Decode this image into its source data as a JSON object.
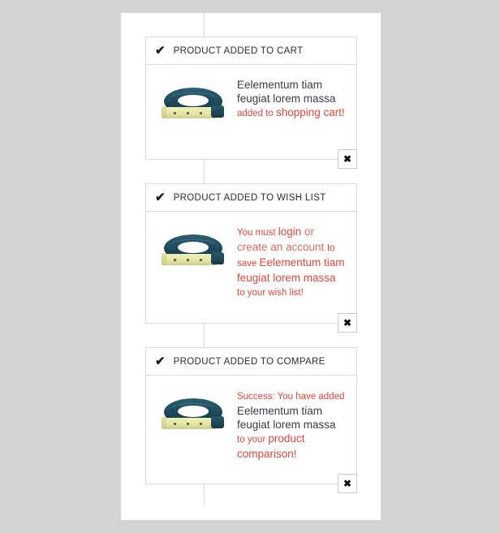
{
  "theme": {
    "page_background": "#d4d3d1",
    "sheet_background": "#ffffff",
    "card_border": "#dcdcdc",
    "title_color": "#2a2a36",
    "alert_red": "#e8443c",
    "product_text_color": "#3b3b4a"
  },
  "icons": {
    "check": "✔",
    "close": "✖"
  },
  "notifications": [
    {
      "id": "added-to-cart",
      "title": "PRODUCT ADDED TO CART",
      "check_icon": "✔",
      "close_label": "✖",
      "product_image_alt": "Eelementum tiam feugiat lorem massa belt",
      "message_parts": [
        {
          "text": "Eelementum tiam feugiat lorem massa ",
          "style": "dark"
        },
        {
          "text": "added to ",
          "style": "small-red"
        },
        {
          "text": "shopping cart!",
          "style": "red"
        }
      ]
    },
    {
      "id": "added-to-wish-list",
      "title": "PRODUCT ADDED TO WISH LIST",
      "check_icon": "✔",
      "close_label": "✖",
      "product_image_alt": "Eelementum tiam feugiat lorem massa belt",
      "message_parts": [
        {
          "text": "You must ",
          "style": "small-red"
        },
        {
          "text": "login ",
          "style": "red"
        },
        {
          "text": "or create an account ",
          "style": "red-soft"
        },
        {
          "text": "to save ",
          "style": "small-red"
        },
        {
          "text": "Eelementum tiam feugiat lorem massa ",
          "style": "red"
        },
        {
          "text": "to your wish list!",
          "style": "small-red"
        }
      ]
    },
    {
      "id": "added-to-compare",
      "title": "PRODUCT ADDED TO COMPARE",
      "check_icon": "✔",
      "close_label": "✖",
      "product_image_alt": "Eelementum tiam feugiat lorem massa belt",
      "message_parts": [
        {
          "text": "Success: You have added ",
          "style": "small-red"
        },
        {
          "text": "Eelementum tiam feugiat lorem massa ",
          "style": "dark"
        },
        {
          "text": "to your ",
          "style": "small-red"
        },
        {
          "text": "product comparison!",
          "style": "red"
        }
      ]
    }
  ]
}
